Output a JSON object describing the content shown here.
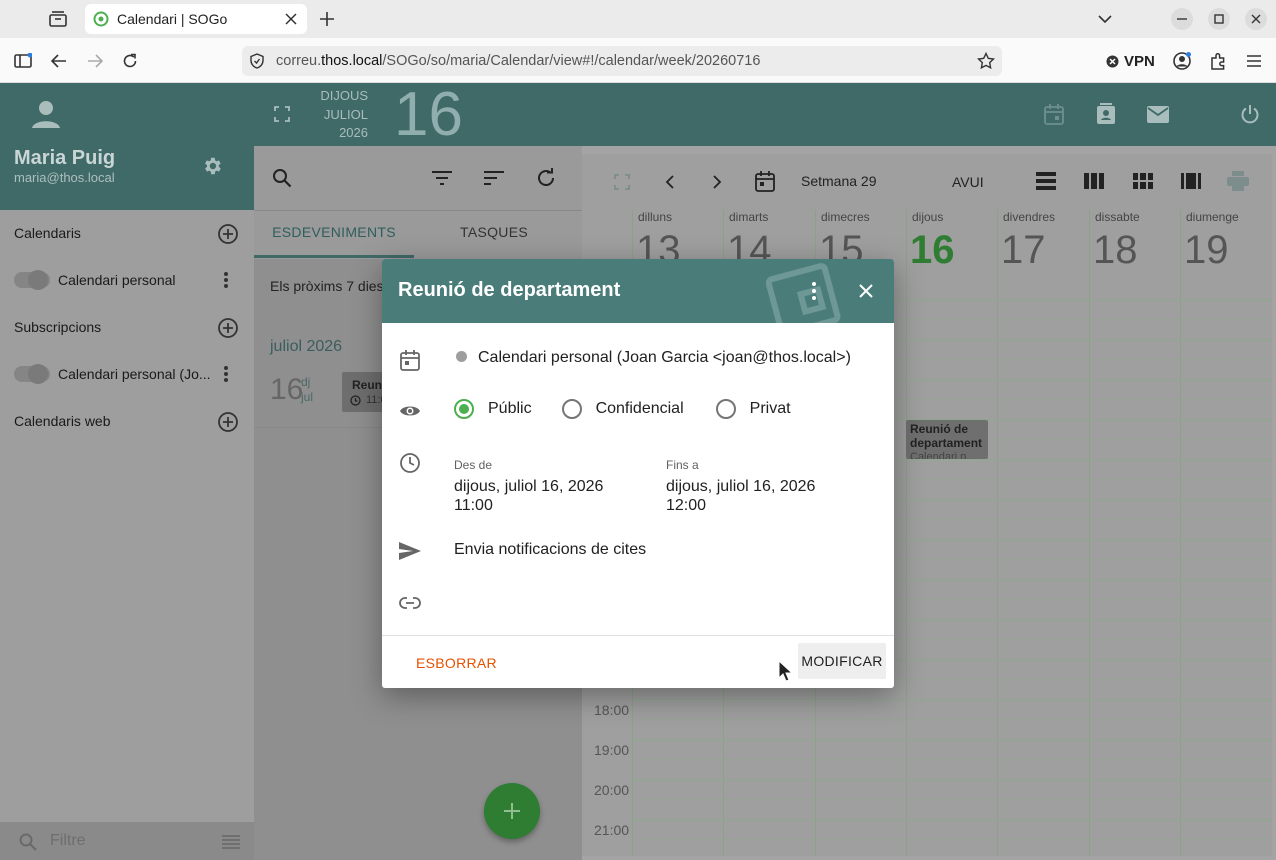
{
  "browser": {
    "tab_title": "Calendari | SOGo",
    "url_prefix": "correu.",
    "url_host": "thos.local",
    "url_path": "/SOGo/so/maria/Calendar/view#!/calendar/week/20260716",
    "vpn_label": "VPN"
  },
  "user": {
    "name": "Maria Puig",
    "email": "maria@thos.local"
  },
  "header": {
    "weekday": "DIJOUS",
    "month": "JULIOL",
    "year": "2026",
    "day": "16"
  },
  "sidebar": {
    "calendars_title": "Calendaris",
    "calendar_personal": "Calendari personal",
    "subscriptions_title": "Subscripcions",
    "subscription_item": "Calendari personal (Jo...",
    "web_calendars_title": "Calendaris web",
    "filter_placeholder": "Filtre"
  },
  "list": {
    "tab_events": "ESDEVENIMENTS",
    "tab_tasks": "TASQUES",
    "range_text": "Els pròxims 7 dies",
    "month_label": "juliol 2026",
    "item_day": "16",
    "item_weekday": "dj",
    "item_month": "jul",
    "item_title": "Reuni",
    "item_time": "11:0"
  },
  "calendar": {
    "week_label": "Setmana 29",
    "today_label": "AVUI",
    "days": [
      {
        "name": "dilluns",
        "num": "13"
      },
      {
        "name": "dimarts",
        "num": "14"
      },
      {
        "name": "dimecres",
        "num": "15"
      },
      {
        "name": "dijous",
        "num": "16"
      },
      {
        "name": "divendres",
        "num": "17"
      },
      {
        "name": "dissabte",
        "num": "18"
      },
      {
        "name": "diumenge",
        "num": "19"
      }
    ],
    "hours": [
      "18:00",
      "19:00",
      "20:00",
      "21:00"
    ],
    "event_title": "Reunió de departament",
    "event_sub": "Calendari p..."
  },
  "modal": {
    "title": "Reunió de departament",
    "calendar_name": "Calendari personal (Joan Garcia <joan@thos.local>)",
    "privacy": {
      "public": "Públic",
      "confidential": "Confidencial",
      "private": "Privat"
    },
    "from_label": "Des de",
    "from_date": "dijous, juliol 16, 2026",
    "from_time": "11:00",
    "to_label": "Fins a",
    "to_date": "dijous, juliol 16, 2026",
    "to_time": "12:00",
    "notify": "Envia notificacions de cites",
    "delete_label": "ESBORRAR",
    "edit_label": "MODIFICAR"
  },
  "colors": {
    "header": "#3f6a68",
    "modal_header": "#4a7c7a",
    "accent": "#4caf50",
    "delete": "#e65100"
  }
}
